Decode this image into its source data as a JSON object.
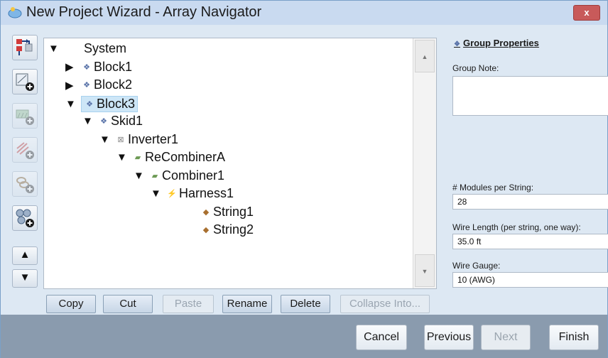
{
  "window": {
    "title": "New Project Wizard - Array Navigator",
    "close_label": "x"
  },
  "toolbar": {
    "buttons": [
      {
        "icon": "hierarchy-icon",
        "enabled": true
      },
      {
        "icon": "add-inverter-icon",
        "enabled": true
      },
      {
        "icon": "add-combiner-icon",
        "enabled": false
      },
      {
        "icon": "add-harness-icon",
        "enabled": false
      },
      {
        "icon": "add-string-icon",
        "enabled": false
      },
      {
        "icon": "add-group-icon",
        "enabled": true
      }
    ],
    "move_up": "▲",
    "move_down": "▼"
  },
  "tree": {
    "nodes": [
      {
        "label": "System",
        "icon": "",
        "expanded": true,
        "has_children": true,
        "depth": 0
      },
      {
        "label": "Block1",
        "icon": "group-icon",
        "expanded": false,
        "has_children": true,
        "depth": 1
      },
      {
        "label": "Block2",
        "icon": "group-icon",
        "expanded": false,
        "has_children": true,
        "depth": 1
      },
      {
        "label": "Block3",
        "icon": "group-icon",
        "expanded": true,
        "has_children": true,
        "depth": 1,
        "selected": true
      },
      {
        "label": "Skid1",
        "icon": "group-icon",
        "expanded": true,
        "has_children": true,
        "depth": 2
      },
      {
        "label": "Inverter1",
        "icon": "inverter-icon",
        "expanded": true,
        "has_children": true,
        "depth": 3
      },
      {
        "label": "ReCombinerA",
        "icon": "combiner-icon",
        "expanded": true,
        "has_children": true,
        "depth": 4
      },
      {
        "label": "Combiner1",
        "icon": "combiner-icon",
        "expanded": true,
        "has_children": true,
        "depth": 5
      },
      {
        "label": "Harness1",
        "icon": "harness-icon",
        "expanded": true,
        "has_children": true,
        "depth": 6
      },
      {
        "label": "String1",
        "icon": "string-icon",
        "expanded": false,
        "has_children": false,
        "depth": 8
      },
      {
        "label": "String2",
        "icon": "string-icon",
        "expanded": false,
        "has_children": false,
        "depth": 8
      }
    ]
  },
  "actions": {
    "copy": "Copy",
    "cut": "Cut",
    "paste": "Paste",
    "rename": "Rename",
    "delete": "Delete",
    "collapse": "Collapse Into..."
  },
  "properties": {
    "title": "Group Properties",
    "group_note_label": "Group Note:",
    "group_note_value": "",
    "modules_label": "# Modules per String:",
    "modules_value": "28",
    "wire_length_label": "Wire Length (per string, one way):",
    "wire_length_value": "35.0 ft",
    "wire_gauge_label": "Wire Gauge:",
    "wire_gauge_value": "10 (AWG)"
  },
  "footer": {
    "cancel": "Cancel",
    "previous": "Previous",
    "next": "Next",
    "finish": "Finish"
  },
  "colors": {
    "selection": "#cde6f7",
    "footer_bg": "#8a9bae",
    "panel_bg": "#dde8f3"
  }
}
